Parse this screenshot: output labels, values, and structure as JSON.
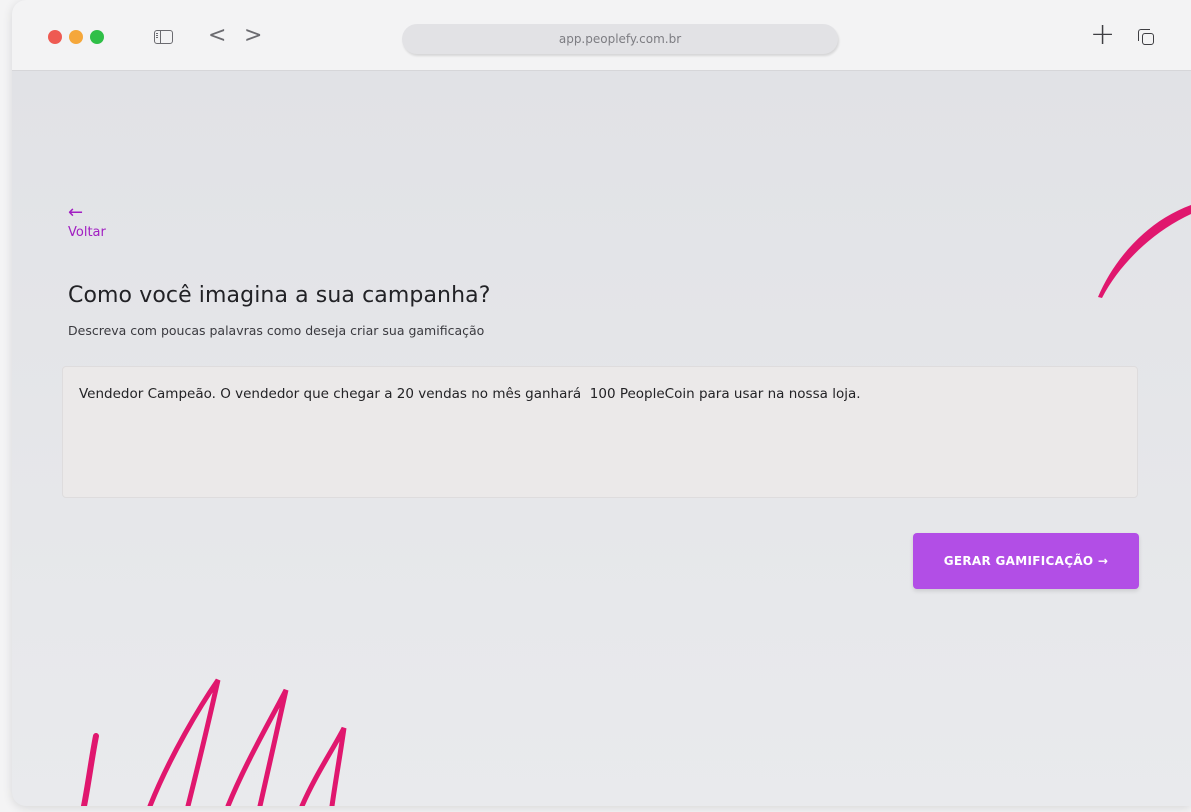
{
  "browser": {
    "url": "app.peoplefy.com.br",
    "icons": {
      "sidebar": "sidebar-icon",
      "back": "chevron-left-icon",
      "forward": "chevron-right-icon",
      "new_tab": "plus-icon",
      "tabs": "tabs-icon"
    },
    "back_glyph": "<",
    "forward_glyph": ">",
    "new_tab_glyph": "+"
  },
  "page": {
    "back_arrow": "←",
    "back_label": "Voltar",
    "title": "Como você imagina a sua campanha?",
    "subtitle": "Descreva com poucas palavras como deseja criar sua gamificação",
    "description_value": "Vendedor Campeão. O vendedor que chegar a 20 vendas no mês ganhará  100 PeopleCoin para usar na nossa loja.",
    "generate_button_label": "GERAR GAMIFICAÇÃO →"
  },
  "colors": {
    "accent_purple": "#b24ee6",
    "link_purple": "#a11ec2",
    "decor_pink": "#e0176e"
  }
}
